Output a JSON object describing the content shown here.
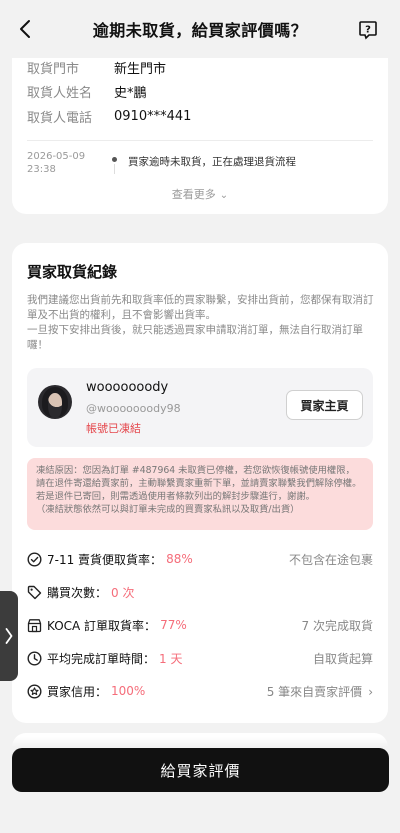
{
  "header": {
    "title": "逾期未取貨，給買家評價嗎？"
  },
  "pickup_info": {
    "rows": [
      {
        "label": "取貨門市",
        "value": "新生門市"
      },
      {
        "label": "取貨人姓名",
        "value": "史*鵬"
      },
      {
        "label": "取貨人電話",
        "value": "0910***441"
      }
    ],
    "timeline": {
      "date": "2026-05-09",
      "time": "23:38",
      "text": "買家逾時未取貨，正在處理退貨流程"
    },
    "see_more_label": "查看更多"
  },
  "buyer_record": {
    "title": "買家取貨紀錄",
    "description": "我們建議您出貨前先和取貨率低的買家聯繫，安排出貨前，您都保有取消訂單及不出貨的權利，且不會影響出貨率。\n一旦按下安排出貨後，就只能透過買家申請取消訂單，無法自行取消訂單囉！",
    "buyer": {
      "name": "wooooooody",
      "handle": "@wooooooody98",
      "status": "帳號已凍結",
      "profile_button": "買家主頁"
    },
    "freeze_note": "凍結原因：您因為訂單 #487964 未取貨已停權，若您欲恢復帳號使用權限，請在退件寄還給賣家前，主動聯繫賣家重新下單，並請賣家聯繫我們解除停權。若是退件已寄回，則需透過使用者條款列出的解封步驟進行，謝謝。\n（凍結狀態依然可以與訂單未完成的買賣家私訊以及取貨/出貨）",
    "stats": [
      {
        "icon": "check-circle-icon",
        "label": "7-11 賣貨便取貨率：",
        "value": "88%",
        "right": "不包含在途包裹"
      },
      {
        "icon": "tag-icon",
        "label": "購買次數：",
        "value": "0 次",
        "right": ""
      },
      {
        "icon": "store-icon",
        "label": "KOCA 訂單取貨率：",
        "value": "77%",
        "right": "7 次完成取貨"
      },
      {
        "icon": "clock-icon",
        "label": "平均完成訂單時間：",
        "value": "1 天",
        "right": "自取貨起算"
      },
      {
        "icon": "star-circle-icon",
        "label": "買家信用：",
        "value": "100%",
        "right": "5 筆來自賣家評價"
      }
    ]
  },
  "cta": {
    "label": "給買家評價"
  },
  "colors": {
    "accent_red": "#e5484d",
    "stat_value_pink": "#f56d7a",
    "note_background": "#fcdcdc",
    "cta_background": "#111111"
  }
}
